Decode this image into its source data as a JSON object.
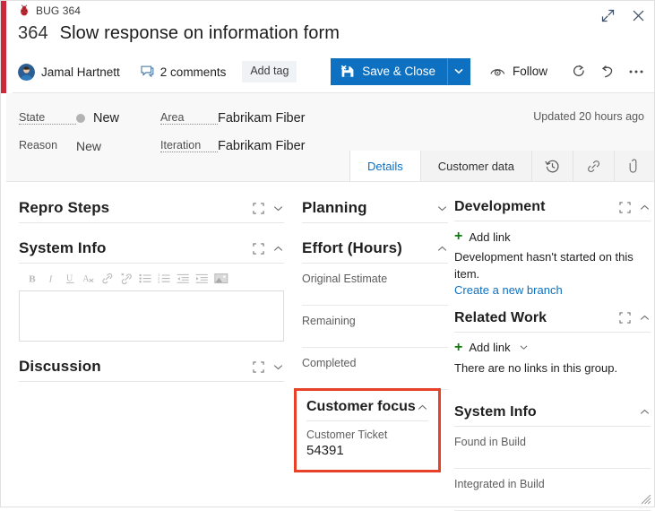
{
  "window": {
    "breadcrumb": "BUG 364",
    "maximize_title": "Maximize",
    "close_title": "Close"
  },
  "header": {
    "work_item_id": "364",
    "title": "Slow response on information form",
    "assignee": "Jamal Hartnett",
    "comments": "2 comments",
    "add_tag": "Add tag"
  },
  "toolbar": {
    "save_label": "Save & Close",
    "save_caret": "save-options",
    "follow_label": "Follow",
    "refresh": "refresh-icon",
    "revert": "revert-icon",
    "more": "•••",
    "accent_blue": "#0e70c0"
  },
  "fields": {
    "state_label": "State",
    "state_value": "New",
    "reason_label": "Reason",
    "reason_value": "New",
    "area_label": "Area",
    "area_value": "Fabrikam Fiber",
    "iteration_label": "Iteration",
    "iteration_value": "Fabrikam Fiber",
    "updated": "Updated 20 hours ago",
    "state_dot_color": "#b2b2b2"
  },
  "tabs": [
    {
      "label": "Details",
      "active": true,
      "kind": "text"
    },
    {
      "label": "Customer data",
      "active": false,
      "kind": "text"
    },
    {
      "label": "",
      "active": false,
      "kind": "icon",
      "icon": "history-icon"
    },
    {
      "label": "",
      "active": false,
      "kind": "icon",
      "icon": "link-icon"
    },
    {
      "label": "",
      "active": false,
      "kind": "icon",
      "icon": "attachment-icon"
    }
  ],
  "left_column": {
    "repro_steps": {
      "title": "Repro Steps",
      "expand_icon": "expand-icon",
      "chevron": "chevron-down-icon"
    },
    "system_info": {
      "title": "System Info",
      "expand_icon": "expand-icon",
      "chevron": "chevron-up-icon",
      "rte_buttons": [
        "bold-icon",
        "italic-icon",
        "underline-icon",
        "clear-format-icon",
        "link-icon",
        "unlink-icon",
        "bullet-list-icon",
        "numbered-list-icon",
        "decrease-indent-icon",
        "increase-indent-icon",
        "image-icon"
      ],
      "editor_value": ""
    },
    "discussion": {
      "title": "Discussion",
      "expand_icon": "expand-icon",
      "chevron": "chevron-down-icon"
    }
  },
  "mid_column": {
    "planning": {
      "title": "Planning",
      "chevron": "chevron-down-icon"
    },
    "effort": {
      "title": "Effort (Hours)",
      "chevron": "chevron-up-icon",
      "rows": [
        {
          "label": "Original Estimate",
          "value": ""
        },
        {
          "label": "Remaining",
          "value": ""
        },
        {
          "label": "Completed",
          "value": ""
        }
      ]
    },
    "customer_focus": {
      "title": "Customer focus",
      "chevron": "chevron-up-icon",
      "ticket_label": "Customer Ticket",
      "ticket_value": "54391",
      "highlight_color": "#e8412a"
    }
  },
  "right_column": {
    "development": {
      "title": "Development",
      "expand_icon": "expand-icon",
      "chevron": "chevron-up-icon",
      "add_link": "Add link",
      "note": "Development hasn't started on this item.",
      "link": "Create a new branch"
    },
    "related_work": {
      "title": "Related Work",
      "expand_icon": "expand-icon",
      "chevron": "chevron-up-icon",
      "add_link": "Add link",
      "add_link_chevron": "chevron-down-icon",
      "note": "There are no links in this group."
    },
    "system_info": {
      "title": "System Info",
      "chevron": "chevron-up-icon",
      "rows": [
        {
          "label": "Found in Build",
          "value": ""
        },
        {
          "label": "Integrated in Build",
          "value": ""
        }
      ]
    }
  }
}
